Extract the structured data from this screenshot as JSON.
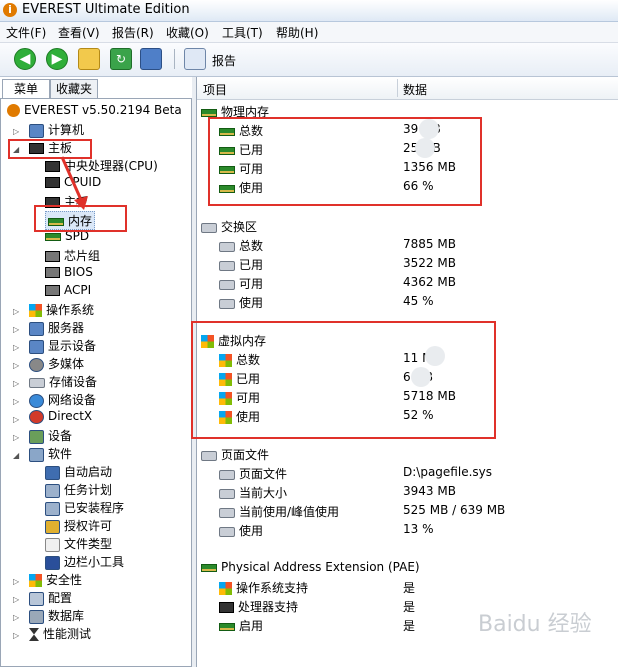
{
  "window": {
    "title": "EVEREST Ultimate Edition"
  },
  "menu": [
    "文件(F)",
    "查看(V)",
    "报告(R)",
    "收藏(O)",
    "工具(T)",
    "帮助(H)"
  ],
  "toolbar": {
    "report_label": "报告"
  },
  "tabs": [
    "菜单",
    "收藏夹"
  ],
  "tree": {
    "root": "EVEREST v5.50.2194 Beta",
    "items": [
      "计算机",
      "主板",
      "中央处理器(CPU)",
      "CPUID",
      "主板",
      "内存",
      "SPD",
      "芯片组",
      "BIOS",
      "ACPI",
      "操作系统",
      "服务器",
      "显示设备",
      "多媒体",
      "存储设备",
      "网络设备",
      "DirectX",
      "设备",
      "软件",
      "自动启动",
      "任务计划",
      "已安装程序",
      "授权许可",
      "文件类型",
      "边栏小工具",
      "安全性",
      "配置",
      "数据库",
      "性能测试"
    ]
  },
  "columns": {
    "item": "项目",
    "data": "数据"
  },
  "sections": {
    "physical": {
      "title": "物理内存",
      "rows": [
        {
          "label": "总数",
          "value": "39 MB"
        },
        {
          "label": "已用",
          "value": "25 MB"
        },
        {
          "label": "可用",
          "value": "1356 MB"
        },
        {
          "label": "使用",
          "value": "66 %"
        }
      ]
    },
    "swap": {
      "title": "交换区",
      "rows": [
        {
          "label": "总数",
          "value": "7885 MB"
        },
        {
          "label": "已用",
          "value": "3522 MB"
        },
        {
          "label": "可用",
          "value": "4362 MB"
        },
        {
          "label": "使用",
          "value": "45 %"
        }
      ]
    },
    "virtual": {
      "title": "虚拟内存",
      "rows": [
        {
          "label": "总数",
          "value": "11 MB"
        },
        {
          "label": "已用",
          "value": "6 MB"
        },
        {
          "label": "可用",
          "value": "5718 MB"
        },
        {
          "label": "使用",
          "value": "52 %"
        }
      ]
    },
    "pagefile": {
      "title": "页面文件",
      "rows": [
        {
          "label": "页面文件",
          "value": "D:\\pagefile.sys"
        },
        {
          "label": "当前大小",
          "value": "3943 MB"
        },
        {
          "label": "当前使用/峰值使用",
          "value": "525 MB / 639 MB"
        },
        {
          "label": "使用",
          "value": "13 %"
        }
      ]
    },
    "pae": {
      "title": "Physical Address Extension (PAE)",
      "rows": [
        {
          "label": "操作系统支持",
          "value": "是"
        },
        {
          "label": "处理器支持",
          "value": "是"
        },
        {
          "label": "启用",
          "value": "是"
        }
      ]
    }
  },
  "watermark": "Baidu 经验"
}
